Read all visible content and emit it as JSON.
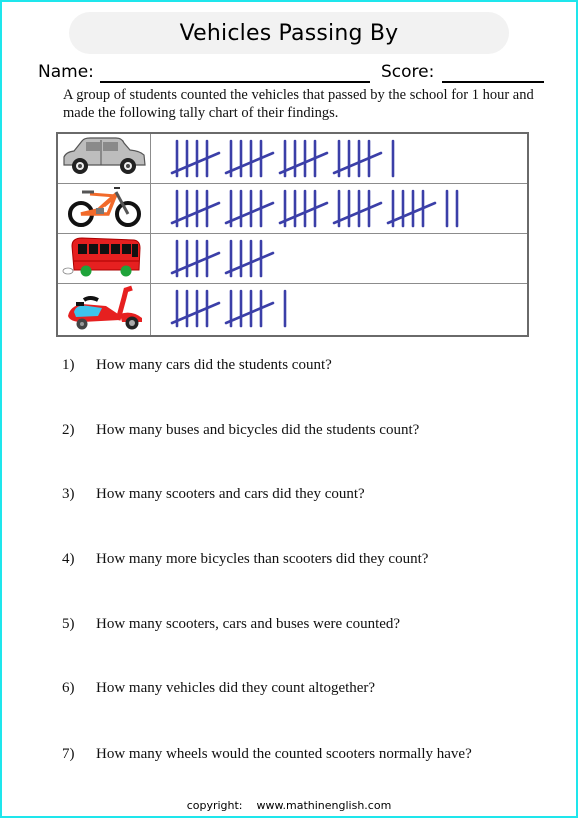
{
  "header": {
    "title": "Vehicles Passing By",
    "name_label": "Name:",
    "score_label": "Score:"
  },
  "intro": "A group of students counted the vehicles that passed by the school for 1 hour and made the following tally chart of their findings.",
  "tally_chart": {
    "rows": [
      {
        "vehicle": "car",
        "icon": "car-icon",
        "count": 21
      },
      {
        "vehicle": "bicycle",
        "icon": "bicycle-icon",
        "count": 27
      },
      {
        "vehicle": "bus",
        "icon": "bus-icon",
        "count": 10
      },
      {
        "vehicle": "scooter",
        "icon": "scooter-icon",
        "count": 11
      }
    ],
    "mark_color": "#3b3fa8"
  },
  "questions": [
    {
      "number": "1)",
      "text": "How many cars did the students count?"
    },
    {
      "number": "2)",
      "text": "How many buses and bicycles did the students count?"
    },
    {
      "number": "3)",
      "text": "How many scooters and cars did they count?"
    },
    {
      "number": "4)",
      "text": "How many more bicycles than scooters did they count?"
    },
    {
      "number": "5)",
      "text": "How many scooters, cars and buses were counted?"
    },
    {
      "number": "6)",
      "text": "How many vehicles did they count altogether?"
    },
    {
      "number": "7)",
      "text": "How many wheels would the counted scooters normally have?"
    }
  ],
  "footer": {
    "copyright_label": "copyright:",
    "website": "www.mathinenglish.com"
  },
  "colors": {
    "page_border": "#1ee6ec",
    "title_bg": "#f2f2f2"
  }
}
